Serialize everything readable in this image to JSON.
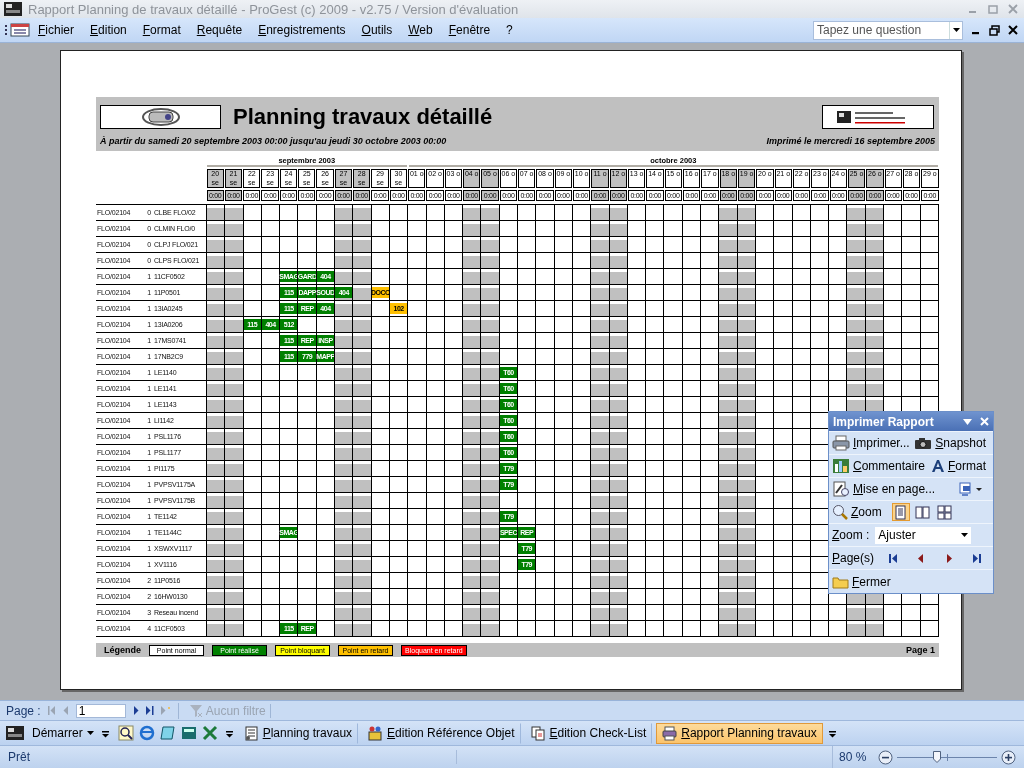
{
  "window": {
    "title": "Rapport Planning de travaux détaillé - ProGest (c) 2009 - v2.75 / Version d'évaluation"
  },
  "menu_bar": {
    "menus": [
      "Fichier",
      "Edition",
      "Format",
      "Requête",
      "Enregistrements",
      "Outils",
      "Web",
      "Fenêtre",
      "?"
    ],
    "search": {
      "placeholder": "Tapez une question"
    }
  },
  "report": {
    "title": "Planning travaux détaillé",
    "range": "À partir du samedi 20 septembre 2003 00:00 jusqu'au jeudi 30 octobre 2003 00:00",
    "printed": "Imprimé le mercredi 16 septembre 2005",
    "months": [
      {
        "label": "septembre 2003",
        "days": [
          {
            "label": "20 se",
            "time": "0:00",
            "weekend": true
          },
          {
            "label": "21 se",
            "time": "0:00",
            "weekend": true
          },
          {
            "label": "22 se",
            "time": "0:00",
            "weekend": false
          },
          {
            "label": "23 se",
            "time": "0:00",
            "weekend": false
          },
          {
            "label": "24 se",
            "time": "0:00",
            "weekend": false
          },
          {
            "label": "25 se",
            "time": "0:00",
            "weekend": false
          },
          {
            "label": "26 se",
            "time": "0:00",
            "weekend": false
          },
          {
            "label": "27 se",
            "time": "0:00",
            "weekend": true
          },
          {
            "label": "28 se",
            "time": "0:00",
            "weekend": true
          },
          {
            "label": "29 se",
            "time": "0:00",
            "weekend": false
          },
          {
            "label": "30 se",
            "time": "0:00",
            "weekend": false
          }
        ]
      },
      {
        "label": "octobre 2003",
        "days": [
          {
            "label": "01 o",
            "time": "0:00",
            "weekend": false
          },
          {
            "label": "02 o",
            "time": "0:00",
            "weekend": false
          },
          {
            "label": "03 o",
            "time": "0:00",
            "weekend": false
          },
          {
            "label": "04 o",
            "time": "0:00",
            "weekend": true
          },
          {
            "label": "05 o",
            "time": "0:00",
            "weekend": true
          },
          {
            "label": "06 o",
            "time": "0:00",
            "weekend": false
          },
          {
            "label": "07 o",
            "time": "0:00",
            "weekend": false
          },
          {
            "label": "08 o",
            "time": "0:00",
            "weekend": false
          },
          {
            "label": "09 o",
            "time": "0:00",
            "weekend": false
          },
          {
            "label": "10 o",
            "time": "0:00",
            "weekend": false
          },
          {
            "label": "11 o",
            "time": "0:00",
            "weekend": true
          },
          {
            "label": "12 o",
            "time": "0:00",
            "weekend": true
          },
          {
            "label": "13 o",
            "time": "0:00",
            "weekend": false
          },
          {
            "label": "14 o",
            "time": "0:00",
            "weekend": false
          },
          {
            "label": "15 o",
            "time": "0:00",
            "weekend": false
          },
          {
            "label": "16 o",
            "time": "0:00",
            "weekend": false
          },
          {
            "label": "17 o",
            "time": "0:00",
            "weekend": false
          },
          {
            "label": "18 o",
            "time": "0:00",
            "weekend": true
          },
          {
            "label": "19 o",
            "time": "0:00",
            "weekend": true
          },
          {
            "label": "20 o",
            "time": "0:00",
            "weekend": false
          },
          {
            "label": "21 o",
            "time": "0:00",
            "weekend": false
          },
          {
            "label": "22 o",
            "time": "0:00",
            "weekend": false
          },
          {
            "label": "23 o",
            "time": "0:00",
            "weekend": false
          },
          {
            "label": "24 o",
            "time": "0:00",
            "weekend": false
          },
          {
            "label": "25 o",
            "time": "0:00",
            "weekend": true
          },
          {
            "label": "26 o",
            "time": "0:00",
            "weekend": true
          },
          {
            "label": "27 o",
            "time": "0:00",
            "weekend": false
          },
          {
            "label": "28 o",
            "time": "0:00",
            "weekend": false
          },
          {
            "label": "29 o",
            "time": "0:00",
            "weekend": false
          }
        ]
      }
    ],
    "rows": [
      {
        "id": "FLO/02104",
        "group": "0",
        "code": "CLBE FLO/02",
        "cells": [
          null,
          null,
          null,
          null,
          null,
          null,
          null,
          null,
          null,
          null,
          null,
          null,
          null,
          null,
          null,
          null,
          null,
          null,
          null,
          null,
          null,
          null,
          null,
          null,
          null,
          null,
          null,
          null,
          null,
          null,
          null,
          null,
          null,
          null,
          null,
          null,
          null,
          null,
          null,
          null
        ]
      },
      {
        "id": "FLO/02104",
        "group": "0",
        "code": "CLMIN FLO/0",
        "cells": [
          null,
          null,
          null,
          null,
          null,
          null,
          null,
          null,
          null,
          null,
          null,
          null,
          null,
          null,
          null,
          null,
          null,
          null,
          null,
          null,
          null,
          null,
          null,
          null,
          null,
          null,
          null,
          null,
          null,
          null,
          null,
          null,
          null,
          null,
          null,
          null,
          null,
          null,
          null,
          null
        ]
      },
      {
        "id": "FLO/02104",
        "group": "0",
        "code": "CLPJ FLO/021",
        "cells": [
          null,
          null,
          null,
          null,
          null,
          null,
          null,
          null,
          null,
          null,
          null,
          null,
          null,
          null,
          null,
          null,
          null,
          null,
          null,
          null,
          null,
          null,
          null,
          null,
          null,
          null,
          null,
          null,
          null,
          null,
          null,
          null,
          null,
          null,
          null,
          null,
          null,
          null,
          null,
          null
        ]
      },
      {
        "id": "FLO/02104",
        "group": "0",
        "code": "CLPS FLO/021",
        "cells": [
          null,
          null,
          null,
          null,
          null,
          null,
          null,
          null,
          null,
          null,
          null,
          null,
          null,
          null,
          null,
          null,
          null,
          null,
          null,
          null,
          null,
          null,
          null,
          null,
          null,
          null,
          null,
          null,
          null,
          null,
          null,
          null,
          null,
          null,
          null,
          null,
          null,
          null,
          null,
          null
        ]
      },
      {
        "id": "FLO/02104",
        "group": "1",
        "code": "11CF0502",
        "cells": [
          null,
          null,
          null,
          null,
          {
            "text": "SMAG",
            "color": "#008000"
          },
          {
            "text": "GARD",
            "color": "#008000"
          },
          {
            "text": "404",
            "color": "#008000"
          },
          null,
          null,
          null,
          null,
          null,
          null,
          null,
          null,
          null,
          null,
          null,
          null,
          null,
          null,
          null,
          null,
          null,
          null,
          null,
          null,
          null,
          null,
          null,
          null,
          null,
          null,
          null,
          null,
          null,
          null,
          null,
          null,
          null
        ]
      },
      {
        "id": "FLO/02104",
        "group": "1",
        "code": "11P0501",
        "cells": [
          null,
          null,
          null,
          null,
          {
            "text": "115",
            "color": "#008000"
          },
          {
            "text": "DAPP",
            "color": "#008000"
          },
          {
            "text": "SOUD",
            "color": "#008000"
          },
          {
            "text": "404",
            "color": "#008000"
          },
          null,
          {
            "text": "DOCC",
            "color": "#ffc000"
          },
          null,
          null,
          null,
          null,
          null,
          null,
          null,
          null,
          null,
          null,
          null,
          null,
          null,
          null,
          null,
          null,
          null,
          null,
          null,
          null,
          null,
          null,
          null,
          null,
          null,
          null,
          null,
          null,
          null,
          null
        ]
      },
      {
        "id": "FLO/02104",
        "group": "1",
        "code": "13IA0245",
        "cells": [
          null,
          null,
          null,
          null,
          {
            "text": "115",
            "color": "#008000"
          },
          {
            "text": "REP",
            "color": "#008000"
          },
          {
            "text": "404",
            "color": "#008000"
          },
          null,
          null,
          null,
          {
            "text": "102",
            "color": "#ffc000"
          },
          null,
          null,
          null,
          null,
          null,
          null,
          null,
          null,
          null,
          null,
          null,
          null,
          null,
          null,
          null,
          null,
          null,
          null,
          null,
          null,
          null,
          null,
          null,
          null,
          null,
          null,
          null,
          null,
          null
        ]
      },
      {
        "id": "FLO/02104",
        "group": "1",
        "code": "13IA0206",
        "cells": [
          null,
          null,
          {
            "text": "115",
            "color": "#008000"
          },
          {
            "text": "404",
            "color": "#008000"
          },
          {
            "text": "512",
            "color": "#008000"
          },
          null,
          null,
          null,
          null,
          null,
          null,
          null,
          null,
          null,
          null,
          null,
          null,
          null,
          null,
          null,
          null,
          null,
          null,
          null,
          null,
          null,
          null,
          null,
          null,
          null,
          null,
          null,
          null,
          null,
          null,
          null,
          null,
          null,
          null,
          null
        ]
      },
      {
        "id": "FLO/02104",
        "group": "1",
        "code": "17MS0741",
        "cells": [
          null,
          null,
          null,
          null,
          {
            "text": "115",
            "color": "#008000"
          },
          {
            "text": "REP",
            "color": "#008000"
          },
          {
            "text": "INSP",
            "color": "#008000"
          },
          null,
          null,
          null,
          null,
          null,
          null,
          null,
          null,
          null,
          null,
          null,
          null,
          null,
          null,
          null,
          null,
          null,
          null,
          null,
          null,
          null,
          null,
          null,
          null,
          null,
          null,
          null,
          null,
          null,
          null,
          null,
          null,
          null
        ]
      },
      {
        "id": "FLO/02104",
        "group": "1",
        "code": "17NB2C9",
        "cells": [
          null,
          null,
          null,
          null,
          {
            "text": "115",
            "color": "#008000"
          },
          {
            "text": "779",
            "color": "#008000"
          },
          {
            "text": "MAPP",
            "color": "#008000"
          },
          null,
          null,
          null,
          null,
          null,
          null,
          null,
          null,
          null,
          null,
          null,
          null,
          null,
          null,
          null,
          null,
          null,
          null,
          null,
          null,
          null,
          null,
          null,
          null,
          null,
          null,
          null,
          null,
          null,
          null,
          null,
          null,
          null
        ]
      },
      {
        "id": "FLO/02104",
        "group": "1",
        "code": "LE1140",
        "cells": [
          null,
          null,
          null,
          null,
          null,
          null,
          null,
          null,
          null,
          null,
          null,
          null,
          null,
          null,
          null,
          null,
          {
            "text": "T60",
            "color": "#008000"
          },
          null,
          null,
          null,
          null,
          null,
          null,
          null,
          null,
          null,
          null,
          null,
          null,
          null,
          null,
          null,
          null,
          null,
          null,
          null,
          null,
          null,
          null,
          null
        ]
      },
      {
        "id": "FLO/02104",
        "group": "1",
        "code": "LE1141",
        "cells": [
          null,
          null,
          null,
          null,
          null,
          null,
          null,
          null,
          null,
          null,
          null,
          null,
          null,
          null,
          null,
          null,
          {
            "text": "T60",
            "color": "#008000"
          },
          null,
          null,
          null,
          null,
          null,
          null,
          null,
          null,
          null,
          null,
          null,
          null,
          null,
          null,
          null,
          null,
          null,
          null,
          null,
          null,
          null,
          null,
          null
        ]
      },
      {
        "id": "FLO/02104",
        "group": "1",
        "code": "LE1143",
        "cells": [
          null,
          null,
          null,
          null,
          null,
          null,
          null,
          null,
          null,
          null,
          null,
          null,
          null,
          null,
          null,
          null,
          {
            "text": "T60",
            "color": "#008000"
          },
          null,
          null,
          null,
          null,
          null,
          null,
          null,
          null,
          null,
          null,
          null,
          null,
          null,
          null,
          null,
          null,
          null,
          null,
          null,
          null,
          null,
          null,
          null
        ]
      },
      {
        "id": "FLO/02104",
        "group": "1",
        "code": "LI1142",
        "cells": [
          null,
          null,
          null,
          null,
          null,
          null,
          null,
          null,
          null,
          null,
          null,
          null,
          null,
          null,
          null,
          null,
          {
            "text": "T60",
            "color": "#008000"
          },
          null,
          null,
          null,
          null,
          null,
          null,
          null,
          null,
          null,
          null,
          null,
          null,
          null,
          null,
          null,
          null,
          null,
          null,
          null,
          null,
          null,
          null,
          null
        ]
      },
      {
        "id": "FLO/02104",
        "group": "1",
        "code": "PSL1176",
        "cells": [
          null,
          null,
          null,
          null,
          null,
          null,
          null,
          null,
          null,
          null,
          null,
          null,
          null,
          null,
          null,
          null,
          {
            "text": "T60",
            "color": "#008000"
          },
          null,
          null,
          null,
          null,
          null,
          null,
          null,
          null,
          null,
          null,
          null,
          null,
          null,
          null,
          null,
          null,
          null,
          null,
          null,
          null,
          null,
          null,
          null
        ]
      },
      {
        "id": "FLO/02104",
        "group": "1",
        "code": "PSL1177",
        "cells": [
          null,
          null,
          null,
          null,
          null,
          null,
          null,
          null,
          null,
          null,
          null,
          null,
          null,
          null,
          null,
          null,
          {
            "text": "T60",
            "color": "#008000"
          },
          null,
          null,
          null,
          null,
          null,
          null,
          null,
          null,
          null,
          null,
          null,
          null,
          null,
          null,
          null,
          null,
          null,
          null,
          null,
          null,
          null,
          null,
          null
        ]
      },
      {
        "id": "FLO/02104",
        "group": "1",
        "code": "PI1175",
        "cells": [
          null,
          null,
          null,
          null,
          null,
          null,
          null,
          null,
          null,
          null,
          null,
          null,
          null,
          null,
          null,
          null,
          {
            "text": "T79",
            "color": "#008000"
          },
          null,
          null,
          null,
          null,
          null,
          null,
          null,
          null,
          null,
          null,
          null,
          null,
          null,
          null,
          null,
          null,
          null,
          null,
          null,
          null,
          null,
          null,
          null
        ]
      },
      {
        "id": "FLO/02104",
        "group": "1",
        "code": "PVPSV1175A",
        "cells": [
          null,
          null,
          null,
          null,
          null,
          null,
          null,
          null,
          null,
          null,
          null,
          null,
          null,
          null,
          null,
          null,
          {
            "text": "T79",
            "color": "#008000"
          },
          null,
          null,
          null,
          null,
          null,
          null,
          null,
          null,
          null,
          null,
          null,
          null,
          null,
          null,
          null,
          null,
          null,
          null,
          null,
          null,
          null,
          null,
          null
        ]
      },
      {
        "id": "FLO/02104",
        "group": "1",
        "code": "PVPSV1175B",
        "cells": [
          null,
          null,
          null,
          null,
          null,
          null,
          null,
          null,
          null,
          null,
          null,
          null,
          null,
          null,
          null,
          null,
          null,
          null,
          null,
          null,
          null,
          null,
          null,
          null,
          null,
          null,
          null,
          null,
          null,
          null,
          null,
          null,
          null,
          null,
          null,
          null,
          null,
          null,
          null,
          null
        ]
      },
      {
        "id": "FLO/02104",
        "group": "1",
        "code": "TE1142",
        "cells": [
          null,
          null,
          null,
          null,
          null,
          null,
          null,
          null,
          null,
          null,
          null,
          null,
          null,
          null,
          null,
          null,
          {
            "text": "T79",
            "color": "#008000"
          },
          null,
          null,
          null,
          null,
          null,
          null,
          null,
          null,
          null,
          null,
          null,
          null,
          null,
          null,
          null,
          null,
          null,
          null,
          null,
          null,
          null,
          null,
          null
        ]
      },
      {
        "id": "FLO/02104",
        "group": "1",
        "code": "TE1144C",
        "cells": [
          null,
          null,
          null,
          null,
          {
            "text": "SMAG",
            "color": "#008000"
          },
          null,
          null,
          null,
          null,
          null,
          null,
          null,
          null,
          null,
          null,
          null,
          {
            "text": "SPEC",
            "color": "#008000"
          },
          {
            "text": "REP",
            "color": "#008000"
          },
          null,
          null,
          null,
          null,
          null,
          null,
          null,
          null,
          null,
          null,
          null,
          null,
          null,
          null,
          null,
          null,
          null,
          null,
          null,
          null,
          null,
          null
        ]
      },
      {
        "id": "FLO/02104",
        "group": "1",
        "code": "XSWXV1117",
        "cells": [
          null,
          null,
          null,
          null,
          null,
          null,
          null,
          null,
          null,
          null,
          null,
          null,
          null,
          null,
          null,
          null,
          null,
          {
            "text": "T79",
            "color": "#008000"
          },
          null,
          null,
          null,
          null,
          null,
          null,
          null,
          null,
          null,
          null,
          null,
          null,
          null,
          null,
          null,
          null,
          null,
          null,
          null,
          null,
          null,
          null
        ]
      },
      {
        "id": "FLO/02104",
        "group": "1",
        "code": "XV1116",
        "cells": [
          null,
          null,
          null,
          null,
          null,
          null,
          null,
          null,
          null,
          null,
          null,
          null,
          null,
          null,
          null,
          null,
          null,
          {
            "text": "T79",
            "color": "#008000"
          },
          null,
          null,
          null,
          null,
          null,
          null,
          null,
          null,
          null,
          null,
          null,
          null,
          null,
          null,
          null,
          null,
          null,
          null,
          null,
          null,
          null,
          null
        ]
      },
      {
        "id": "FLO/02104",
        "group": "2",
        "code": "11P0516",
        "cells": [
          null,
          null,
          null,
          null,
          null,
          null,
          null,
          null,
          null,
          null,
          null,
          null,
          null,
          null,
          null,
          null,
          null,
          null,
          null,
          null,
          null,
          null,
          null,
          null,
          null,
          null,
          null,
          null,
          null,
          null,
          null,
          null,
          null,
          null,
          null,
          null,
          null,
          null,
          null,
          null
        ]
      },
      {
        "id": "FLO/02104",
        "group": "2",
        "code": "16HW0130",
        "cells": [
          null,
          null,
          null,
          null,
          null,
          null,
          null,
          null,
          null,
          null,
          null,
          null,
          null,
          null,
          null,
          null,
          null,
          null,
          null,
          null,
          null,
          null,
          null,
          null,
          null,
          null,
          null,
          null,
          null,
          null,
          null,
          null,
          null,
          null,
          null,
          null,
          null,
          null,
          null,
          null
        ]
      },
      {
        "id": "FLO/02104",
        "group": "3",
        "code": "Reseau incend",
        "cells": [
          null,
          null,
          null,
          null,
          null,
          null,
          null,
          null,
          null,
          null,
          null,
          null,
          null,
          null,
          null,
          null,
          null,
          null,
          null,
          null,
          null,
          null,
          null,
          null,
          null,
          null,
          null,
          null,
          null,
          null,
          null,
          null,
          null,
          null,
          null,
          null,
          null,
          null,
          null,
          null
        ]
      },
      {
        "id": "FLO/02104",
        "group": "4",
        "code": "11CF0503",
        "cells": [
          null,
          null,
          null,
          null,
          {
            "text": "115",
            "color": "#008000"
          },
          {
            "text": "REP",
            "color": "#008000"
          },
          null,
          null,
          null,
          null,
          null,
          null,
          null,
          null,
          null,
          null,
          null,
          null,
          null,
          null,
          null,
          null,
          null,
          null,
          null,
          null,
          null,
          null,
          null,
          null,
          null,
          null,
          null,
          null,
          null,
          null,
          null,
          null,
          null,
          null
        ]
      }
    ],
    "legend": {
      "title": "Légende",
      "items": [
        {
          "label": "Point normal",
          "color": "#ffffff"
        },
        {
          "label": "Point réalisé",
          "color": "#008000"
        },
        {
          "label": "Point bloquant",
          "color": "#ffff00"
        },
        {
          "label": "Point en retard",
          "color": "#ffc000"
        },
        {
          "label": "Bloquant en retard",
          "color": "#ff0000"
        }
      ]
    },
    "page": "Page 1"
  },
  "print_panel": {
    "title": "Imprimer Rapport",
    "action_rows": [
      [
        {
          "kind": "print",
          "label": "Imprimer..."
        },
        {
          "kind": "camera",
          "label": "Snapshot"
        }
      ],
      [
        {
          "kind": "comment",
          "label": "Commentaire"
        },
        {
          "kind": "font",
          "label": "Format"
        }
      ],
      [
        {
          "kind": "setup",
          "label": "Mise en page..."
        },
        {
          "kind": "export"
        }
      ]
    ],
    "zoom_label": "Zoom",
    "views": [
      {
        "kind": "single",
        "selected": true
      },
      {
        "kind": "double",
        "selected": false
      },
      {
        "kind": "quad",
        "selected": false
      }
    ],
    "zoom_field": {
      "label": "Zoom :",
      "value": "Ajuster"
    },
    "pages_label": "Page(s)",
    "close_label": "Fermer"
  },
  "page_bar": {
    "label": "Page :",
    "value": "1",
    "filter": {
      "label": "Aucun filtre",
      "disabled": true
    }
  },
  "taskbar": {
    "start": "Démarrer",
    "quick_launch": [
      {
        "kind": "search"
      },
      {
        "kind": "browser"
      },
      {
        "kind": "note"
      },
      {
        "kind": "calc"
      },
      {
        "kind": "excel"
      }
    ],
    "tasks": [
      {
        "kind": "form",
        "label": "Planning travaux",
        "selected": false
      },
      {
        "kind": "reference",
        "label": "Edition Référence Objet",
        "selected": false
      },
      {
        "kind": "checklist",
        "label": "Edition Check-List",
        "selected": false
      },
      {
        "kind": "report",
        "label": "Rapport Planning travaux",
        "selected": true
      }
    ]
  },
  "status_bar": {
    "text": "Prêt",
    "zoom": "80 %",
    "zoom_slider": {
      "level": 0.4
    }
  }
}
